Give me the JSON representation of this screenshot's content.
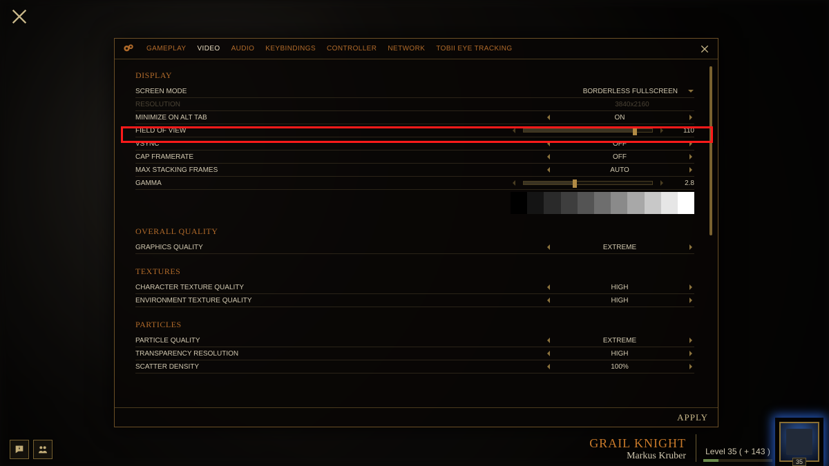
{
  "tabs": [
    "GAMEPLAY",
    "VIDEO",
    "AUDIO",
    "KEYBINDINGS",
    "CONTROLLER",
    "NETWORK",
    "TOBII EYE TRACKING"
  ],
  "active_tab": 1,
  "sections": {
    "display": {
      "title": "DISPLAY",
      "screen_mode_label": "SCREEN MODE",
      "screen_mode_value": "BORDERLESS FULLSCREEN",
      "resolution_label": "RESOLUTION",
      "resolution_value": "3840x2160",
      "minimize_label": "MINIMIZE ON ALT TAB",
      "minimize_value": "ON",
      "fov_label": "FIELD OF VIEW",
      "fov_value": "110",
      "fov_fill_pct": 85,
      "vsync_label": "VSYNC",
      "vsync_value": "OFF",
      "cap_label": "CAP FRAMERATE",
      "cap_value": "OFF",
      "max_stack_label": "MAX STACKING FRAMES",
      "max_stack_value": "AUTO",
      "gamma_label": "GAMMA",
      "gamma_value": "2.8",
      "gamma_fill_pct": 38
    },
    "overall": {
      "title": "OVERALL QUALITY",
      "gfx_label": "GRAPHICS QUALITY",
      "gfx_value": "EXTREME"
    },
    "textures": {
      "title": "TEXTURES",
      "char_label": "CHARACTER TEXTURE QUALITY",
      "char_value": "HIGH",
      "env_label": "ENVIRONMENT TEXTURE QUALITY",
      "env_value": "HIGH"
    },
    "particles": {
      "title": "PARTICLES",
      "pq_label": "PARTICLE QUALITY",
      "pq_value": "EXTREME",
      "tr_label": "TRANSPARENCY RESOLUTION",
      "tr_value": "HIGH",
      "sd_label": "SCATTER DENSITY",
      "sd_value": "100%"
    }
  },
  "footer": {
    "apply": "APPLY"
  },
  "character": {
    "title": "GRAIL KNIGHT",
    "name": "Markus Kruber",
    "level_text": "Level 35 ( + 143 )",
    "portrait_level": "35"
  },
  "calibration_shades": [
    "#000000",
    "#141414",
    "#2a2a2a",
    "#3e3e3e",
    "#545454",
    "#6e6e6e",
    "#8a8a8a",
    "#a8a8a8",
    "#c8c8c8",
    "#e6e6e6",
    "#ffffff"
  ]
}
